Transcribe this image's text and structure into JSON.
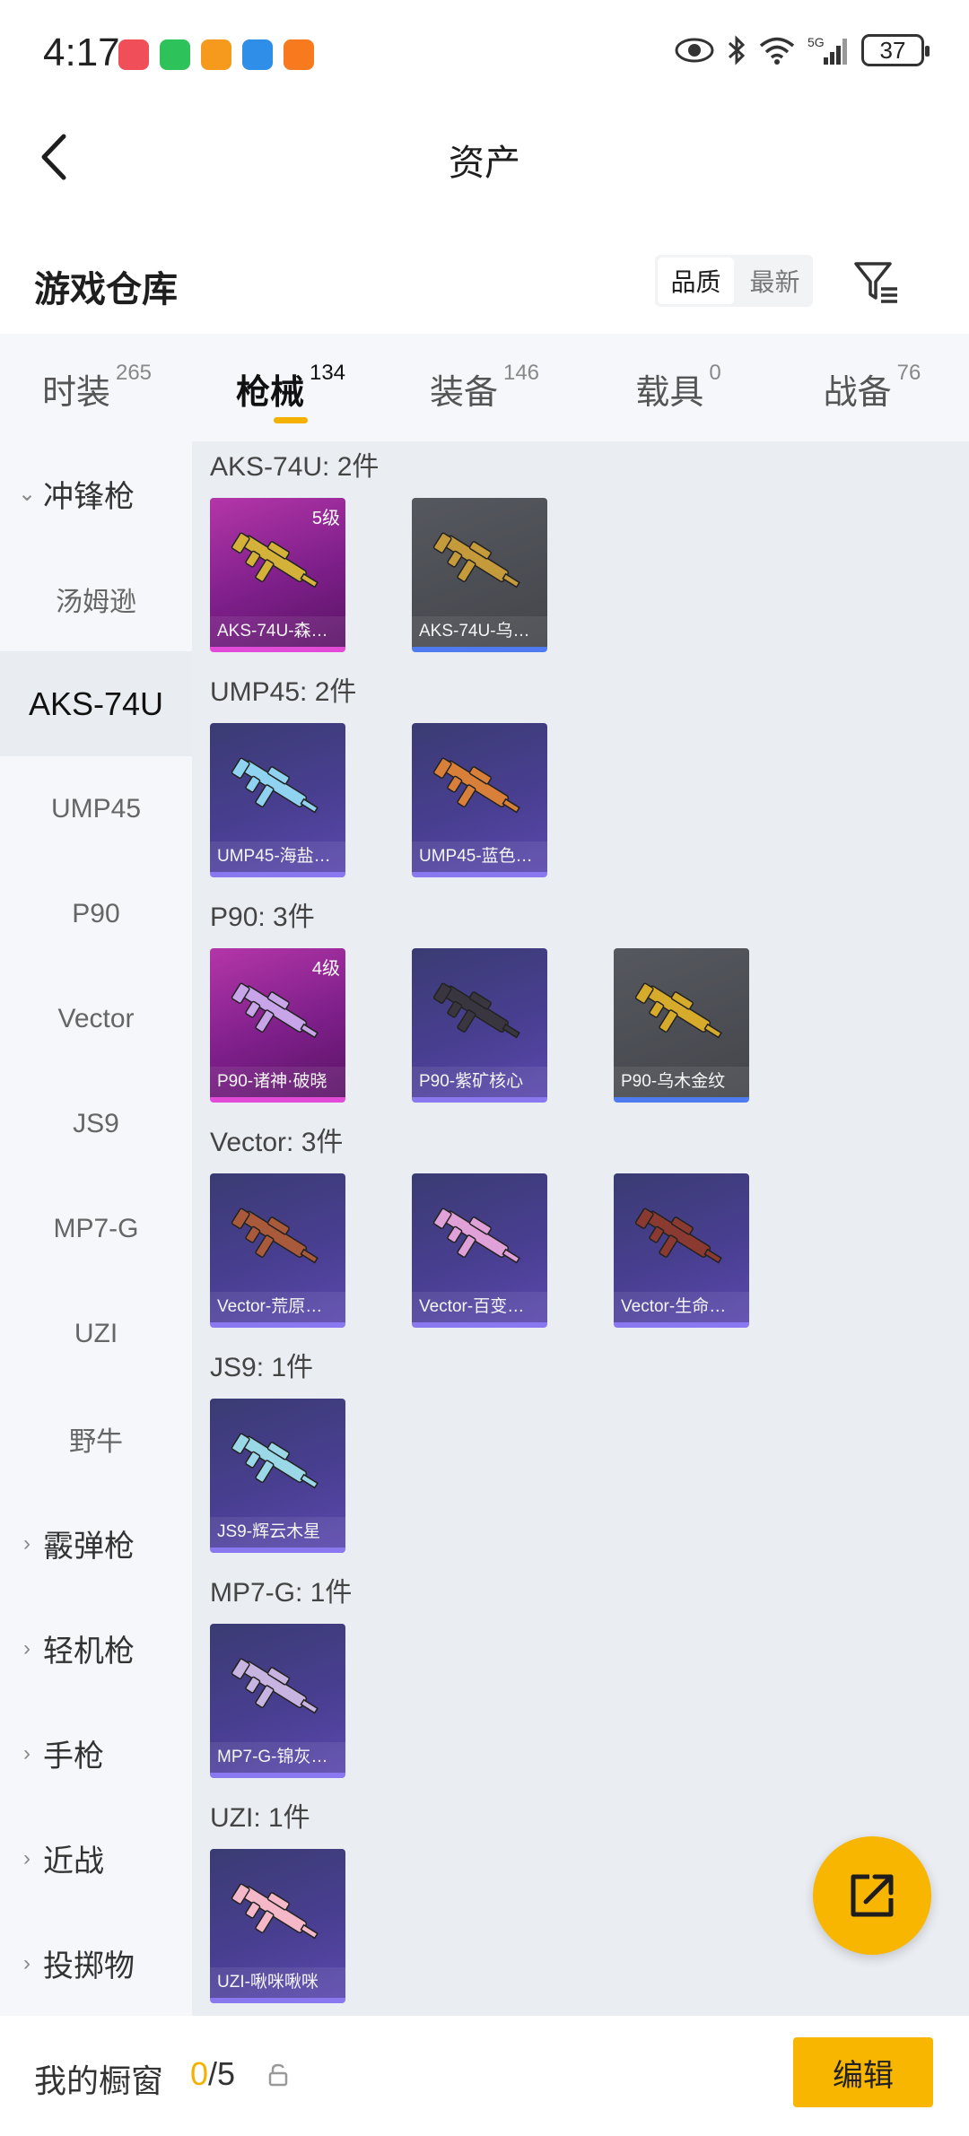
{
  "status_bar": {
    "time": "4:17",
    "battery": "37",
    "app_icon_colors": [
      "#f04f5a",
      "#2dc35a",
      "#f69a1d",
      "#2f8fe8",
      "#f77b1e"
    ]
  },
  "header": {
    "title": "资产",
    "back_icon": "chevron-left-icon"
  },
  "warehouse": {
    "title": "游戏仓库",
    "sort_options": [
      "品质",
      "最新"
    ],
    "sort_selected": "品质",
    "filter_icon": "filter-icon"
  },
  "category_tabs": [
    {
      "label": "时装",
      "count": "265",
      "active": false
    },
    {
      "label": "枪械",
      "count": "134",
      "active": true
    },
    {
      "label": "装备",
      "count": "146",
      "active": false
    },
    {
      "label": "载具",
      "count": "0",
      "active": false
    },
    {
      "label": "战备",
      "count": "76",
      "active": false
    }
  ],
  "sidenav": {
    "items": [
      {
        "label": "冲锋枪",
        "type": "group",
        "expanded": true
      },
      {
        "label": "汤姆逊",
        "type": "sub"
      },
      {
        "label": "AKS-74U",
        "type": "sub",
        "selected": true
      },
      {
        "label": "UMP45",
        "type": "sub"
      },
      {
        "label": "P90",
        "type": "sub"
      },
      {
        "label": "Vector",
        "type": "sub"
      },
      {
        "label": "JS9",
        "type": "sub"
      },
      {
        "label": "MP7-G",
        "type": "sub"
      },
      {
        "label": "UZI",
        "type": "sub"
      },
      {
        "label": "野牛",
        "type": "sub"
      },
      {
        "label": "霰弹枪",
        "type": "group",
        "expanded": false
      },
      {
        "label": "轻机枪",
        "type": "group",
        "expanded": false
      },
      {
        "label": "手枪",
        "type": "group",
        "expanded": false
      },
      {
        "label": "近战",
        "type": "group",
        "expanded": false
      },
      {
        "label": "投掷物",
        "type": "group",
        "expanded": false
      }
    ]
  },
  "sections": [
    {
      "title": "AKS-74U: 2件",
      "items": [
        {
          "name": "AKS-74U-森…",
          "rarity": "pink",
          "level": "5级",
          "gun_color": "#d4b23a"
        },
        {
          "name": "AKS-74U-乌…",
          "rarity": "gray",
          "level": "",
          "gun_color": "#c49a3a"
        }
      ]
    },
    {
      "title": "UMP45: 2件",
      "items": [
        {
          "name": "UMP45-海盐…",
          "rarity": "purple",
          "level": "",
          "gun_color": "#8fd3f0"
        },
        {
          "name": "UMP45-蓝色…",
          "rarity": "purple",
          "level": "",
          "gun_color": "#d8803a"
        }
      ]
    },
    {
      "title": "P90: 3件",
      "items": [
        {
          "name": "P90-诸神·破晓",
          "rarity": "pink",
          "level": "4级",
          "gun_color": "#c8a4e8"
        },
        {
          "name": "P90-紫矿核心",
          "rarity": "purple",
          "level": "",
          "gun_color": "#3a3640"
        },
        {
          "name": "P90-乌木金纹",
          "rarity": "gray",
          "level": "",
          "gun_color": "#d6aa2a"
        }
      ]
    },
    {
      "title": "Vector: 3件",
      "items": [
        {
          "name": "Vector-荒原…",
          "rarity": "purple",
          "level": "",
          "gun_color": "#a85a3a"
        },
        {
          "name": "Vector-百变…",
          "rarity": "purple",
          "level": "",
          "gun_color": "#e0a0d8"
        },
        {
          "name": "Vector-生命…",
          "rarity": "purple",
          "level": "",
          "gun_color": "#8a3a30"
        }
      ]
    },
    {
      "title": "JS9: 1件",
      "items": [
        {
          "name": "JS9-辉云木星",
          "rarity": "purple",
          "level": "",
          "gun_color": "#9ad8e8"
        }
      ]
    },
    {
      "title": "MP7-G: 1件",
      "items": [
        {
          "name": "MP7-G-锦灰…",
          "rarity": "purple",
          "level": "",
          "gun_color": "#c8b4e0"
        }
      ]
    },
    {
      "title": "UZI: 1件",
      "items": [
        {
          "name": "UZI-啾咪啾咪",
          "rarity": "purple",
          "level": "",
          "gun_color": "#f4b8c8"
        }
      ]
    }
  ],
  "fab": {
    "icon": "share-icon",
    "color": "#f8b600"
  },
  "bottom_bar": {
    "label": "我的橱窗",
    "current": "0",
    "total": "/5",
    "lock_icon": "lock-icon",
    "edit_label": "编辑"
  }
}
